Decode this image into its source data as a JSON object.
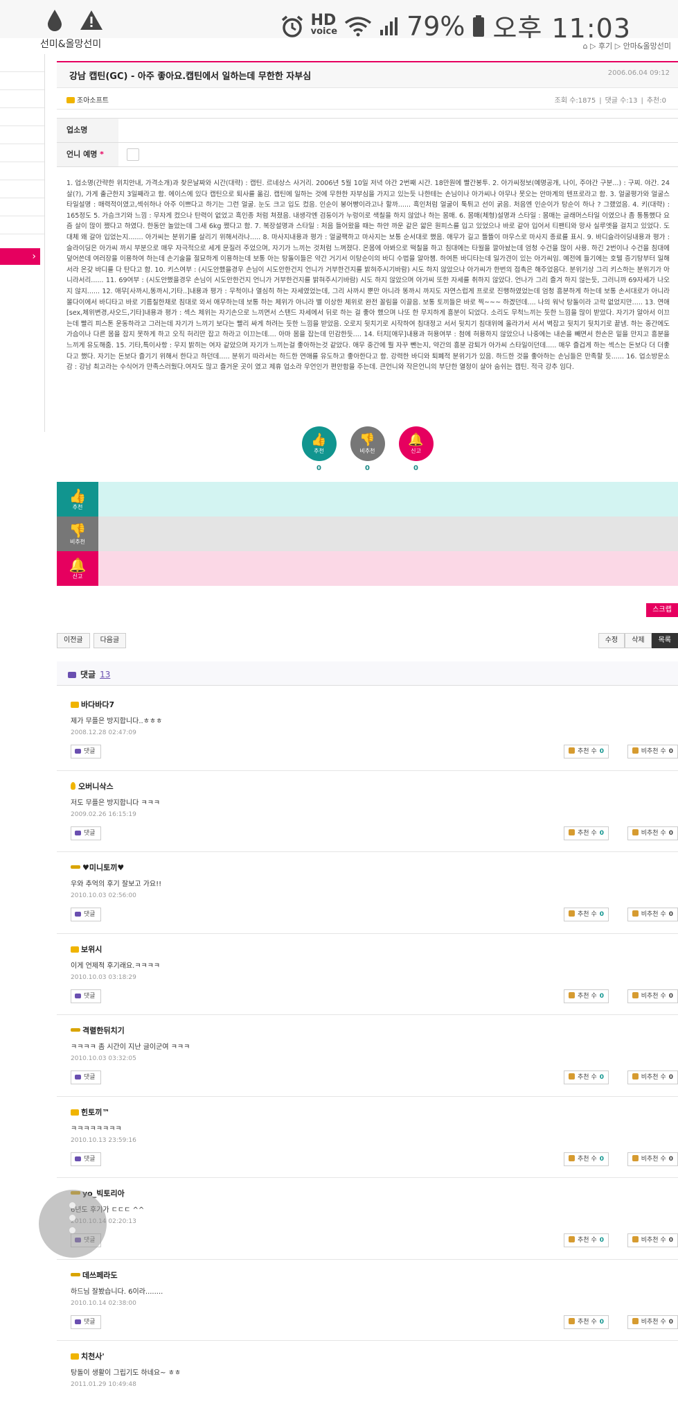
{
  "statusbar": {
    "battery": "79%",
    "time": "오후 11:03",
    "hd": "HD",
    "voice": "voice"
  },
  "topstrip": {
    "left_title": "선미&올망선미",
    "crumb": "⌂  ▷ 후기  ▷ 안마&올망선미"
  },
  "post": {
    "title": "강남 캡틴(GC) - 아주 좋아요.캡틴에서 일하는데 무한한 자부심",
    "date": "2006.06.04 09:12",
    "author": "조아소프트",
    "views": "조회 수:1875",
    "comments_count": "댓글 수:13",
    "recommend": "추천:0",
    "field1_label": "업소명",
    "field2_label": "언니 예명",
    "required_mark": "*",
    "body": "1. 업소명(간략한 위치안내, 가격소개)과 찾은날짜와 시간(대략) : 캡틴. 르네상스 사거리. 2006년 5월 10일 저녁 야간 2번째 시간. 18만원에 빨간봉투. 2. 아가씨정보(예명공개, 나이, 주야간 구분...) : 구찌. 야간. 24살(?), 가게 출근한지 3일째라고 함. 에이스에 있다 캡틴으로 퇴사를 옮김. 캡틴에 일하는 것에 무한한 자부심을 가지고 있는듯 나한테는 손님이나 아가씨나 아무나 못오는 안마계의 텐프로라고 함. 3. 얼굴평가와 얼굴스타일설명 : 매력적이였고,섹쉬하나 아주 이쁘다고 하기는 그런 얼굴. 눈도 크고 입도 컸음. 인순이 붕어빵이라고나 할까...... 흑인처럼 얼굴이 툭튀고 선이 굵음. 처음엔 인순이가 탕순이 하나 ? 그랬었음. 4. 키(대략) : 165정도 5. 가슴크기와 느낌 : 무자게 컸으나 탄력이 없었고 흑인종 처럼 쳐졌음. 내생각엔 검둥이가 누렁이로 색칠을 하지 않았나 하는 몸매. 6. 몸매(체형)설명과 스타일 : 몸매는 글래머스타일 이였으나 좀 통통했다 요즘 살이 많이 쪘다고 하였다. 한동안 놀았는데 그새 6kg 쪘다고 함. 7. 복장설명과 스타일 : 처음 들어왔을 때는 하얀 까운 같은 얇은 원피스를 입고 있었으나 바로 같아 입어서 티팬티와 망사 실루엣을 걸치고 있었다. 도대체 왜 갈아 입었는지....... 아가씨는 분위기를 살리기 위해서라나..... 8. 마사지내용과 평가 : 얼굴팩하고 마사지는 보통 순서대로 했음. 애무가 길고 뜰뜰이 마우스로 마사지 종료를 표시. 9. 바디슬라이딩내용과 평가 : 슬라이딩은 아가씨 까시 부분으로 매우 자극적으로 세게 문질러 주었으며, 자기가 느끼는 것처럼 느껴졌다. 온몸에 아봐으로 떡칠을 하고 침대에는 타월을 깔아놨는데 엄청 수건을 많이 사용. 하긴 2번이나 수건을 침대에 덮어쓴데 여러장을 이용하여 하는데 손기술을 절묘하게 이용하는데 보통 아는 탕돌이들은 악간 거기서 이탕순이의 바디 수법을 알아챔. 하여튼 바디타는데 일가견이 있는 아가씨임. 예전에 들기에는 호텔 증기탕부터 일해서라 온갖 바디를 다 탄다고 함. 10. 키스여부 : (시도안했을경우 손님이 시도안한건지 언니가 거부한건지를 밝혀주시기바람) 시도 하지 않았으나 아가씨가 한번의 접촉은 해주었음다. 분위기상 그리 키스하는 분위기가 아니라서리...... 11. 69여부 : (시도안했을경우 손님이 시도안한건지 언니가 거부한건지를 밝혀주시기바람) 시도 하지 않았으며 아가씨 또한 자세를 취하지 않았다. 언나가 그리 즐겨 하지 않는듯, 그러니까 69자세가 나오지 않지...... 12. 애무[사까시,똥까시,기타..]내용과 평가 : 무척이나 열심히 하는 자세였었는데, 그리 사까시 뿐만 아니라 똥까시 까지도 자연스럽게 프로로 진행하였었는데 엄청 흥분하게 하는데 보통 손서대로가 아니라 몰다이에서 바디타고 바로 기름칠한채로 침대로 와서 애무하는데 보통 하는 체위가 아니라 별 이상한 체위로 완전 꼴림을 이끌음. 보통 토끼들은 바로 찍~~~ 하겠던데.... 나의 워낙 탕돌이라 고락 없었지만..... 13. 연애[sex,체위변경,사오드,기타]내용과 평가 : 섹스 체위는 자기손으로 느끼면서 스탠드 자세에서 뒤로 하는 걸 좋아 했으며 나또 한 무지하게 흥분이 되었다. 소리도 무척느끼는 듯한 느낌을 많이 받았다. 자기가 알아서 이끄는데 빨리 피스톤 운동하라고 그러는데 자기가 느끼기 보다는 빨리 싸게 하려는 듯한 느낌을 받았음. 오로지 뒷치기로 시작하여 침대정고 서서 뒷치기 침대위에 올라가서 서서 벽잡고 뒷치기 뒷치기로 끝냄. 하는 중간에도 가슴이나 다른 몸을 잡지 못하게 하고 오직 허리만 잡고 하라고 이끄는데.... 아마 몸을 잡는데 민감한듯.... 14. 터치[애무]내용과 허용여부 : 첨에 허용하지 않았으나 나중에는 내손을 빼면서 한손은 밑을 만지고 흥분을 느끼게 유도해줌. 15. 기타,특이사항 : 무지 밝히는 여자 같았으며 자기가 느끼는걸 좋아하는것 같았다. 애무 중간에 뭘 자꾸 뺀는지, 약간의 흥분 감퇴가 아가씨 스타일이던데..... 매우 즐겁게 하는 섹스는 돈보다 더 더좋다고 했다. 자기는 돈보다 즐기기 위해서 한다고 하던데..... 분위기 따라서는 하드한 연애를 유도하고 좋아한다고 함. 강력한 바디와 퇴폐적 분위기가 있음. 하드한 것을 좋아하는 손님들은 만족할 듯...... 16. 업소방문소감 : 강남 최고라는 수식어가 만족스러웠다.여자도 많고 즐거운 곳이 였고 제휴 업소라 우언인가 편안함을 주는데. 큰언니와 작은언니의 부단한 열정이 살아 숨쉬는 캡틴. 적극 강추 임다."
  },
  "votes": {
    "up_label": "추천",
    "down_label": "비추천",
    "report_label": "신고",
    "up_count": "0",
    "down_count": "0",
    "report_count": "0"
  },
  "scrap_label": "스크랩",
  "nav": {
    "prev": "이전글",
    "next": "다음글",
    "edit": "수정",
    "delete": "삭제",
    "list": "목록"
  },
  "comment_header": {
    "label": "댓글",
    "count": "13"
  },
  "comment_ui": {
    "reply": "댓글",
    "rec_label": "추천 수",
    "nonrec_label": "비추천 수"
  },
  "comments": [
    {
      "nick": "바다바다7",
      "text": "제가 무플은 방지합니다..ㅎㅎㅎ",
      "date": "2008.12.28 02:47:09",
      "rec": "0",
      "nonrec": "0",
      "badge": "crown"
    },
    {
      "nick": "오버니삭스",
      "text": "저도 무플은 방지합니다 ㅋㅋㅋ",
      "date": "2009.02.26 16:15:19",
      "rec": "0",
      "nonrec": "0",
      "badge": "bulb"
    },
    {
      "nick": "♥미니토끼♥",
      "text": "우와 추억의 후기 잘보고 가요!!",
      "date": "2010.10.03 02:56:00",
      "rec": "0",
      "nonrec": "0",
      "badge": "lv"
    },
    {
      "nick": "보위시",
      "text": "이게 언제적 후기래요.ㅋㅋㅋㅋ",
      "date": "2010.10.03 03:18:29",
      "rec": "0",
      "nonrec": "0",
      "badge": "crown"
    },
    {
      "nick": "격렬한뒤치기",
      "text": "ㅋㅋㅋㅋ 좀 시간이 지난 글이군여 ㅋㅋㅋ",
      "date": "2010.10.03 03:32:05",
      "rec": "0",
      "nonrec": "0",
      "badge": "lv"
    },
    {
      "nick": "힌토끼™",
      "text": "ㅋㅋㅋㅋㅋㅋㅋㅋ",
      "date": "2010.10.13 23:59:16",
      "rec": "0",
      "nonrec": "0",
      "badge": "crown"
    },
    {
      "nick": "yo_빅토리아",
      "text": "6년도 후기가 ㄷㄷㄷ ^^",
      "date": "2010.10.14 02:20:13",
      "rec": "0",
      "nonrec": "0",
      "badge": "lv"
    },
    {
      "nick": "데쓰페라도",
      "text": "하드님 잘봤습니다. 6이라........",
      "date": "2010.10.14 02:38:00",
      "rec": "0",
      "nonrec": "0",
      "badge": "lv"
    },
    {
      "nick": "치천사'",
      "text": "탕돌이 생활이 그립기도 하네요~ ㅎㅎ",
      "date": "2011.01.29 10:49:48",
      "rec": "0",
      "nonrec": "0",
      "badge": "crown"
    }
  ]
}
